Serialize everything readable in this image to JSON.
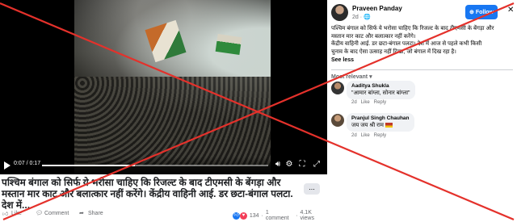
{
  "video": {
    "time": "0:07 / 0:17",
    "progress": 0.41,
    "caption": "पश्चिम बंगाल को सिर्फ ये भरोसा चाहिए कि रिजल्ट के बाद टीएमसी के बेंगड़ा और मस्तान मार काट और बलात्कार नहीं करेंगे। केंद्रीय वाहिनी आई. डर छटा-बंगाल पलटा. देश में...",
    "more_label": "..."
  },
  "actions": {
    "like": "Like",
    "comment": "Comment",
    "share": "Share",
    "reaction_count": "134",
    "comment_count": "1 comment",
    "views": "4.1K views"
  },
  "post": {
    "author": "Praveen Panday",
    "meta": "2d · 🌐",
    "follow_label": "Follow",
    "text_lines": [
      "पश्चिम बंगाल को सिर्फ ये भरोसा चाहिए कि रिजल्ट के बाद टीएमसी के बेंगड़ा और",
      "मस्तान मार काट और बलात्कार नहीं करेंगे।",
      "केंद्रीय वाहिनी आई. डर छटा-बंगाल पलटा। देश में आज से पहले कभी किसी",
      "चुनाव के बाद ऐसा उत्साह नहीं दिखा, जो बंगाल में दिख रहा है।"
    ],
    "see_less": "See less"
  },
  "comments": {
    "sort_label": "Most relevant",
    "items": [
      {
        "name": "Aaditya Shukla",
        "text": "\"आमार बांग्ला, सोनार बांग्ला\"",
        "time": "2d",
        "like": "Like",
        "reply": "Reply"
      },
      {
        "name": "Pranjul Singh Chauhan",
        "text": "जय जय श्री राम",
        "time": "2d",
        "like": "Like",
        "reply": "Reply"
      }
    ]
  },
  "overlay": {
    "x_color": "#e4312b"
  }
}
